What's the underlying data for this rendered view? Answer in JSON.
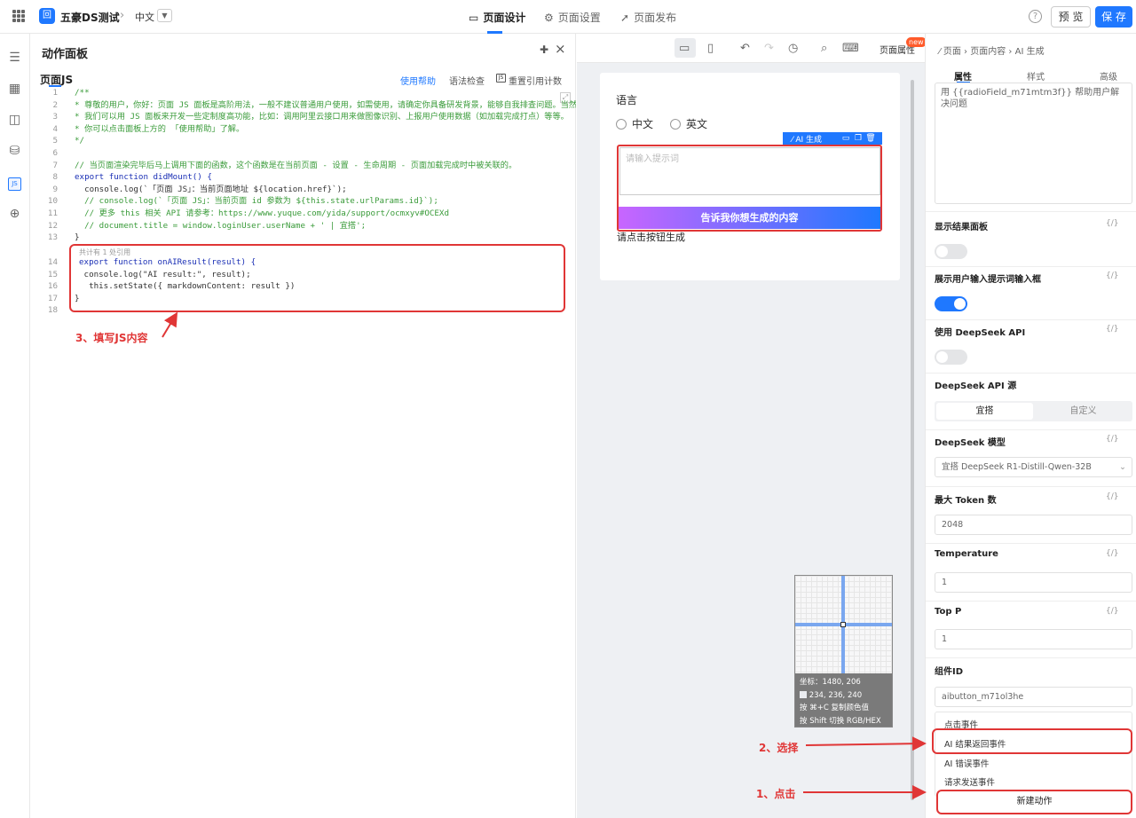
{
  "app": {
    "name": "五豪DS测试",
    "lang": "中文",
    "logo_glyph": "回"
  },
  "top_tabs": [
    {
      "label": "页面设计"
    },
    {
      "label": "页面设置"
    },
    {
      "label": "页面发布"
    }
  ],
  "top_actions": {
    "help": "?",
    "preview": "预 览",
    "save": "保 存"
  },
  "sidebar_icons": [
    "outline-icon",
    "components-icon",
    "layout-icon",
    "datasource-icon",
    "js-icon",
    "globe-icon"
  ],
  "panel": {
    "title": "动作面板",
    "subtitle": "页面JS",
    "help_link": "使用帮助",
    "lint": "语法检查",
    "reset": "重置引用计数",
    "js_badge": "JS",
    "ref_hint": "共计有 1 处引用"
  },
  "code_lines": [
    {
      "n": "1",
      "t": "/**"
    },
    {
      "n": "2",
      "t": "* 尊敬的用户，你好：页面 JS 面板是高阶用法，一般不建议普通用户使用，如需使用，请确定你具备研发背景，能够自我排查问题。当然"
    },
    {
      "n": "3",
      "t": "* 我们可以用 JS 面板来开发一些定制度高功能，比如：调用阿里云接口用来做图像识别、上报用户使用数据（如加载完成打点）等等。"
    },
    {
      "n": "4",
      "t": "* 你可以点击面板上方的 「使用帮助」了解。"
    },
    {
      "n": "5",
      "t": "*/"
    },
    {
      "n": "6",
      "t": ""
    },
    {
      "n": "7",
      "t": "// 当页面渲染完毕后马上调用下面的函数，这个函数是在当前页面 - 设置 - 生命周期 - 页面加载完成时中被关联的。"
    },
    {
      "n": "8",
      "t": "export function didMount() {"
    },
    {
      "n": "9",
      "t": "  console.log(`「页面 JS」：当前页面地址 ${location.href}`);"
    },
    {
      "n": "10",
      "t": "  // console.log(`「页面 JS」：当前页面 id 参数为 ${this.state.urlParams.id}`);"
    },
    {
      "n": "11",
      "t": "  // 更多 this 相关 API 请参考：https://www.yuque.com/yida/support/ocmxyv#OCEXd"
    },
    {
      "n": "12",
      "t": "  // document.title = window.loginUser.userName + ' | 宜搭';"
    },
    {
      "n": "13",
      "t": "}"
    },
    {
      "n": "14",
      "t": "export function onAIResult(result) {"
    },
    {
      "n": "15",
      "t": " console.log(\"AI result:\", result);"
    },
    {
      "n": "16",
      "t": "  this.setState({ markdownContent: result })"
    },
    {
      "n": "17",
      "t": "}"
    },
    {
      "n": "18",
      "t": ""
    }
  ],
  "annotations": {
    "step1": "1、点击",
    "step2": "2、选择",
    "step3": "3、填写JS内容"
  },
  "canvas": {
    "page_props": "页面属性",
    "new_badge": "new",
    "field_label": "语言",
    "radio_options": [
      "中文",
      "英文"
    ],
    "ai_toolbar": "AI 生成",
    "ai_placeholder": "请输入提示词",
    "ai_button": "告诉我你想生成的内容",
    "hint": "请点击按钮生成"
  },
  "color_picker": {
    "coords": "坐标：1480, 206",
    "rgb": "234, 236, 240",
    "copy_hint": "按 ⌘+C 复制颜色值",
    "shift_hint": "按 Shift 切换 RGB/HEX",
    "swatch_color": "#eaecf0"
  },
  "right_panel": {
    "breadcrumb": [
      "页面",
      "页面内容",
      "AI 生成"
    ],
    "tabs": [
      "属性",
      "样式",
      "高级"
    ],
    "prompt_text": "用 {{radioField_m71mtm3f}} 帮助用户解决问题",
    "fx": "{/}",
    "sections": {
      "show_result": "显示结果面板",
      "show_input": "展示用户输入提示词输入框",
      "use_deepseek": "使用 DeepSeek API",
      "api_source": "DeepSeek API 源",
      "model": "DeepSeek 模型",
      "max_token": "最大 Token 数",
      "temperature": "Temperature",
      "top_p": "Top P",
      "component_id": "组件ID"
    },
    "toggles": {
      "show_result": false,
      "show_input": true,
      "use_deepseek": false
    },
    "segment": [
      "宜搭",
      "自定义"
    ],
    "model_value": "宜搭 DeepSeek R1-Distill-Qwen-32B",
    "max_token_value": "2048",
    "temperature_value": "1",
    "top_p_value": "1",
    "component_id_value": "aibutton_m71ol3he",
    "events": [
      "点击事件",
      "AI 结果返回事件",
      "AI 错误事件",
      "请求发送事件"
    ],
    "new_action": "新建动作"
  },
  "colors": {
    "accent": "#1f78ff",
    "annotation_red": "#e03636"
  }
}
